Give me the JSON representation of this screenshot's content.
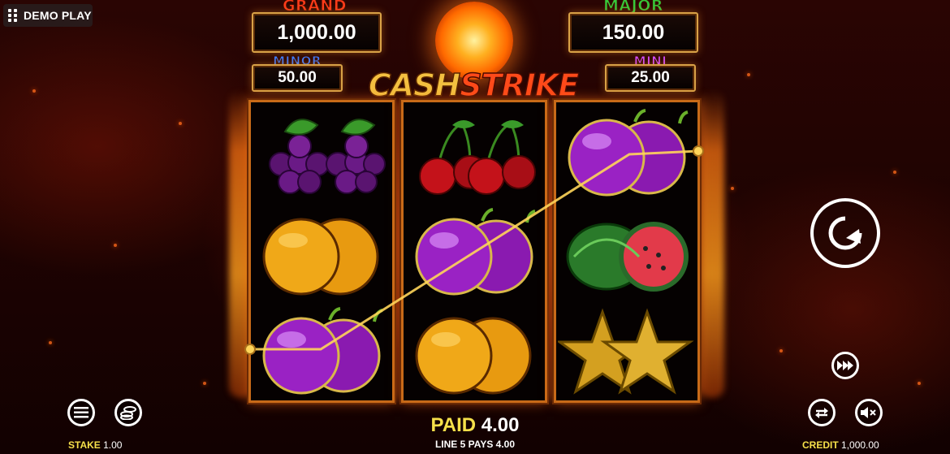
{
  "badge": {
    "label": "DEMO PLAY"
  },
  "jackpots": {
    "grand": {
      "title": "GRAND",
      "value": "1,000.00",
      "color": "#ff3b1a"
    },
    "major": {
      "title": "MAJOR",
      "value": "150.00",
      "color": "#35c93a"
    },
    "minor": {
      "title": "MINOR",
      "value": "50.00",
      "color": "#3b7bff"
    },
    "mini": {
      "title": "MINI",
      "value": "25.00",
      "color": "#d14bff"
    }
  },
  "logo": {
    "part1": "CASH",
    "part2": "STRIKE"
  },
  "reels": [
    [
      "grapes",
      "orange",
      "plum"
    ],
    [
      "cherries",
      "plum",
      "orange"
    ],
    [
      "plum",
      "watermelon",
      "star"
    ]
  ],
  "win": {
    "paid_label": "PAID",
    "paid_value": "4.00",
    "line_text": "LINE 5 PAYS 4.00"
  },
  "footer": {
    "stake_label": "STAKE",
    "stake_value": "1.00",
    "credit_label": "CREDIT",
    "credit_value": "1,000.00"
  },
  "icons": {
    "menu": "menu-icon",
    "coins": "coins-icon",
    "spin": "spin-icon",
    "turbo": "fast-forward-icon",
    "autoplay": "autoplay-icon",
    "sound": "mute-icon"
  },
  "colors": {
    "accent": "#f5e04a",
    "reel_border": "#c86a18",
    "payline": "#ffd55a"
  }
}
